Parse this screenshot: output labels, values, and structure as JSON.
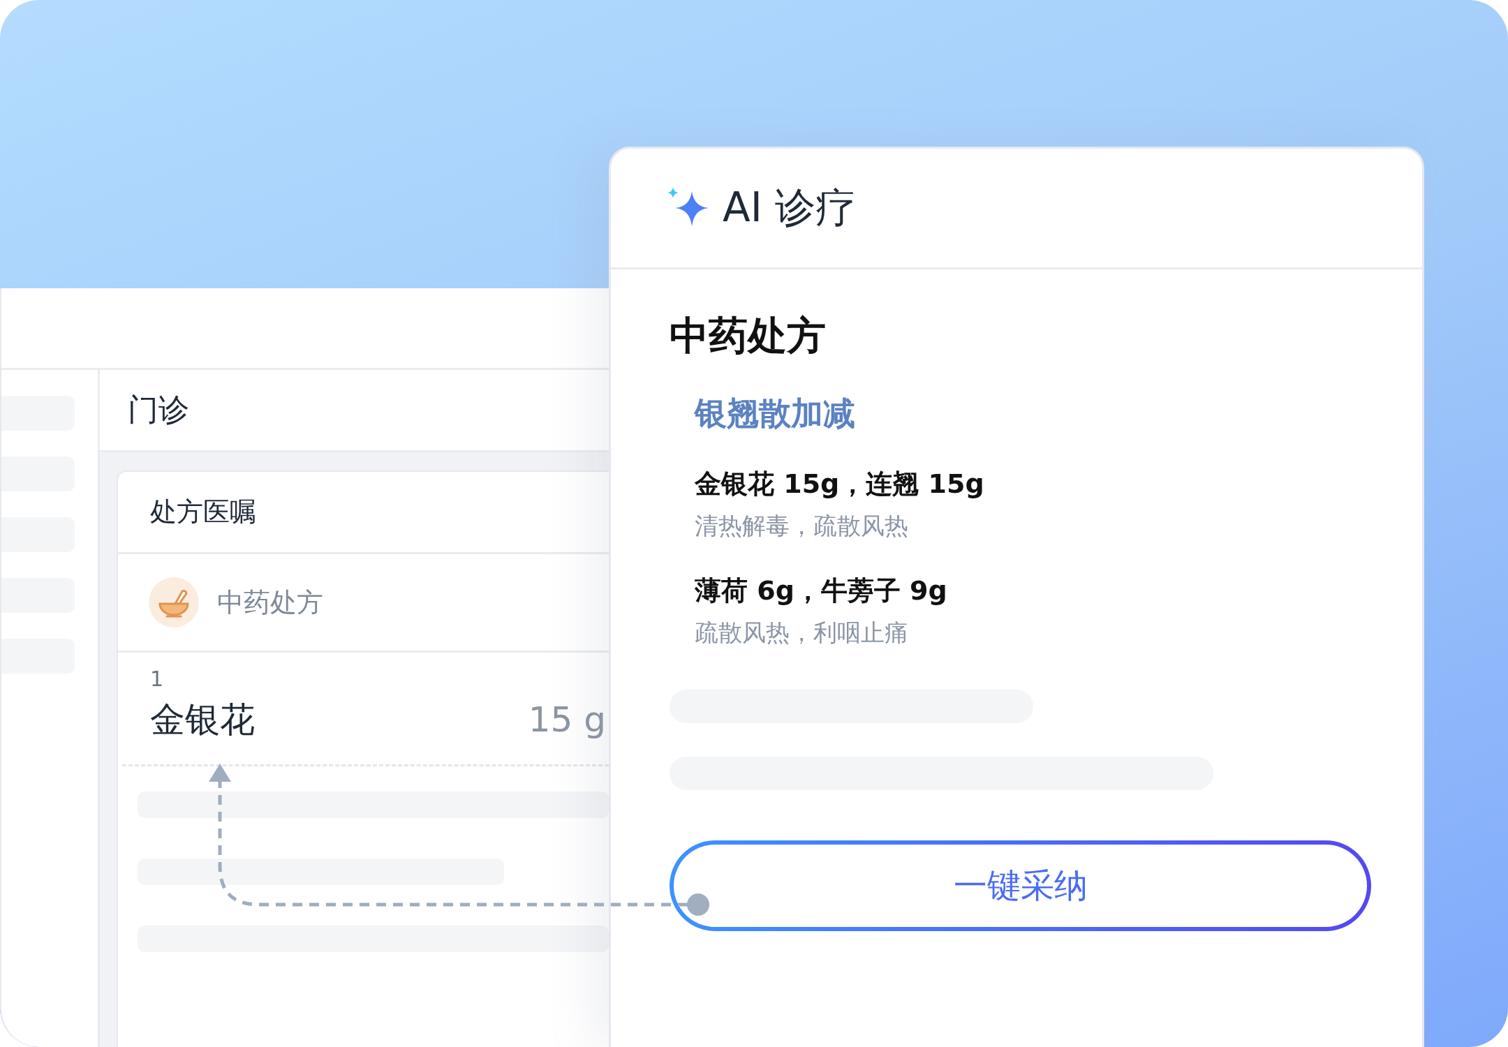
{
  "left_app": {
    "section_title": "门诊",
    "card": {
      "title": "处方医嘱",
      "category": "中药处方",
      "items": [
        {
          "index": "1",
          "name": "金银花",
          "dose": "15 g"
        }
      ]
    }
  },
  "ai_panel": {
    "title": "AI 诊疗",
    "heading": "中药处方",
    "formula": "银翘散加减",
    "herbs": [
      {
        "text": "金银花 15g，连翘 15g",
        "effect": "清热解毒，疏散风热"
      },
      {
        "text": "薄荷 6g，牛蒡子 9g",
        "effect": "疏散风热，利咽止痛"
      }
    ],
    "action": "一键采纳"
  }
}
